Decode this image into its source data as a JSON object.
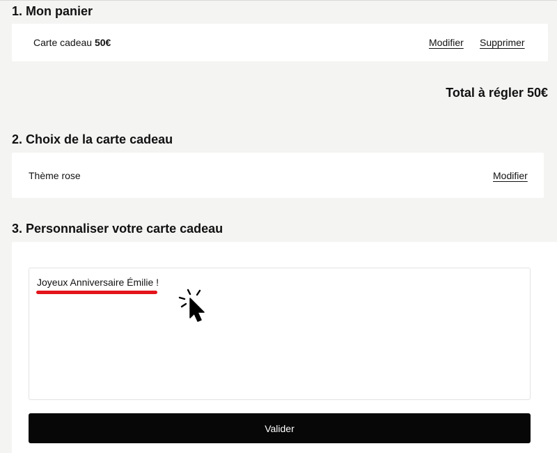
{
  "cart": {
    "title": "1. Mon panier",
    "item_label": "Carte cadeau",
    "item_amount": "50€",
    "modify_label": "Modifier",
    "delete_label": "Supprimer"
  },
  "total": {
    "label": "Total à régler",
    "amount": "50€"
  },
  "card_choice": {
    "title": "2. Choix de la carte cadeau",
    "theme": "Thème rose",
    "modify_label": "Modifier"
  },
  "personalize": {
    "title": "3. Personnaliser votre carte cadeau",
    "message_value": "Joyeux Anniversaire Émilie !",
    "validate_label": "Valider"
  },
  "colors": {
    "background": "#f4f4f3",
    "card": "#ffffff",
    "button": "#070707",
    "highlight_underline": "#e3141b"
  },
  "icons": {
    "cursor": "click-cursor-icon"
  }
}
